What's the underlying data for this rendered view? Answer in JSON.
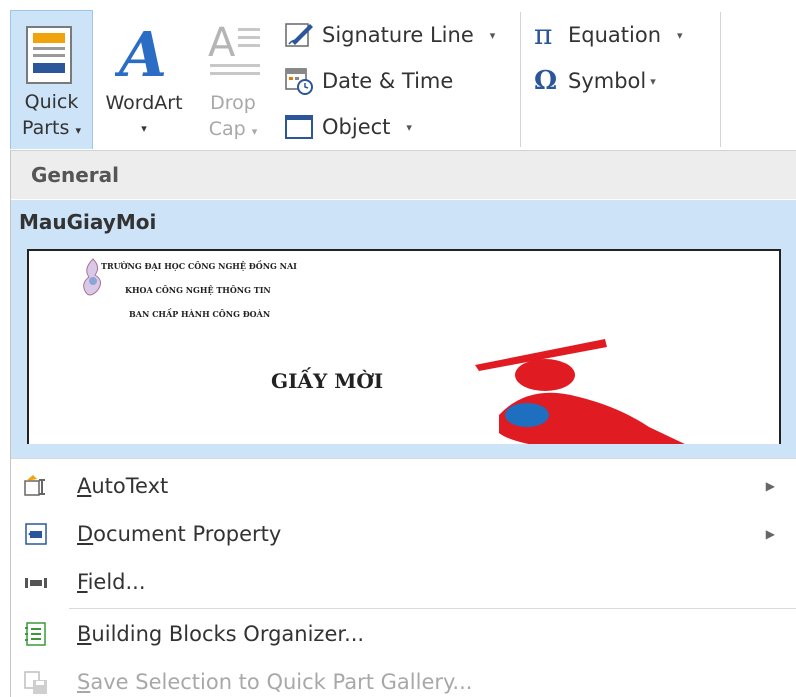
{
  "ribbon": {
    "quick_parts": {
      "line1": "Quick",
      "line2": "Parts"
    },
    "wordart": {
      "label": "WordArt"
    },
    "dropcap": {
      "line1": "Drop",
      "line2": "Cap"
    },
    "signature_line": "Signature Line",
    "date_time": "Date & Time",
    "object": "Object",
    "equation": "Equation",
    "symbol": "Symbol",
    "dropdown_glyph": "▾"
  },
  "gallery": {
    "header": "General",
    "item_title": "MauGiayMoi",
    "preview": {
      "line1": "TRƯỜNG ĐẠI HỌC CÔNG NGHỆ ĐỒNG NAI",
      "line2": "KHOA CÔNG NGHỆ THÔNG TIN",
      "line3": "BAN CHẤP HÀNH CÔNG ĐOÀN",
      "heading": "GIẤY MỜI"
    }
  },
  "menu": {
    "items": [
      {
        "label": "AutoText",
        "icon": "autotext-icon",
        "has_submenu": true,
        "disabled": false
      },
      {
        "label": "Document Property",
        "icon": "document-property-icon",
        "has_submenu": true,
        "disabled": false
      },
      {
        "label": "Field...",
        "icon": "field-icon",
        "has_submenu": false,
        "disabled": false
      },
      {
        "label": "Building Blocks Organizer...",
        "icon": "building-blocks-icon",
        "has_submenu": false,
        "disabled": false
      },
      {
        "label": "Save Selection to Quick Part Gallery...",
        "icon": "save-selection-icon",
        "has_submenu": false,
        "disabled": true
      }
    ],
    "submenu_glyph": "▶"
  },
  "colors": {
    "accent": "#2b579a",
    "hover": "#cde3f7",
    "logo_red": "#e01b22",
    "logo_blue": "#1f6fc1"
  }
}
